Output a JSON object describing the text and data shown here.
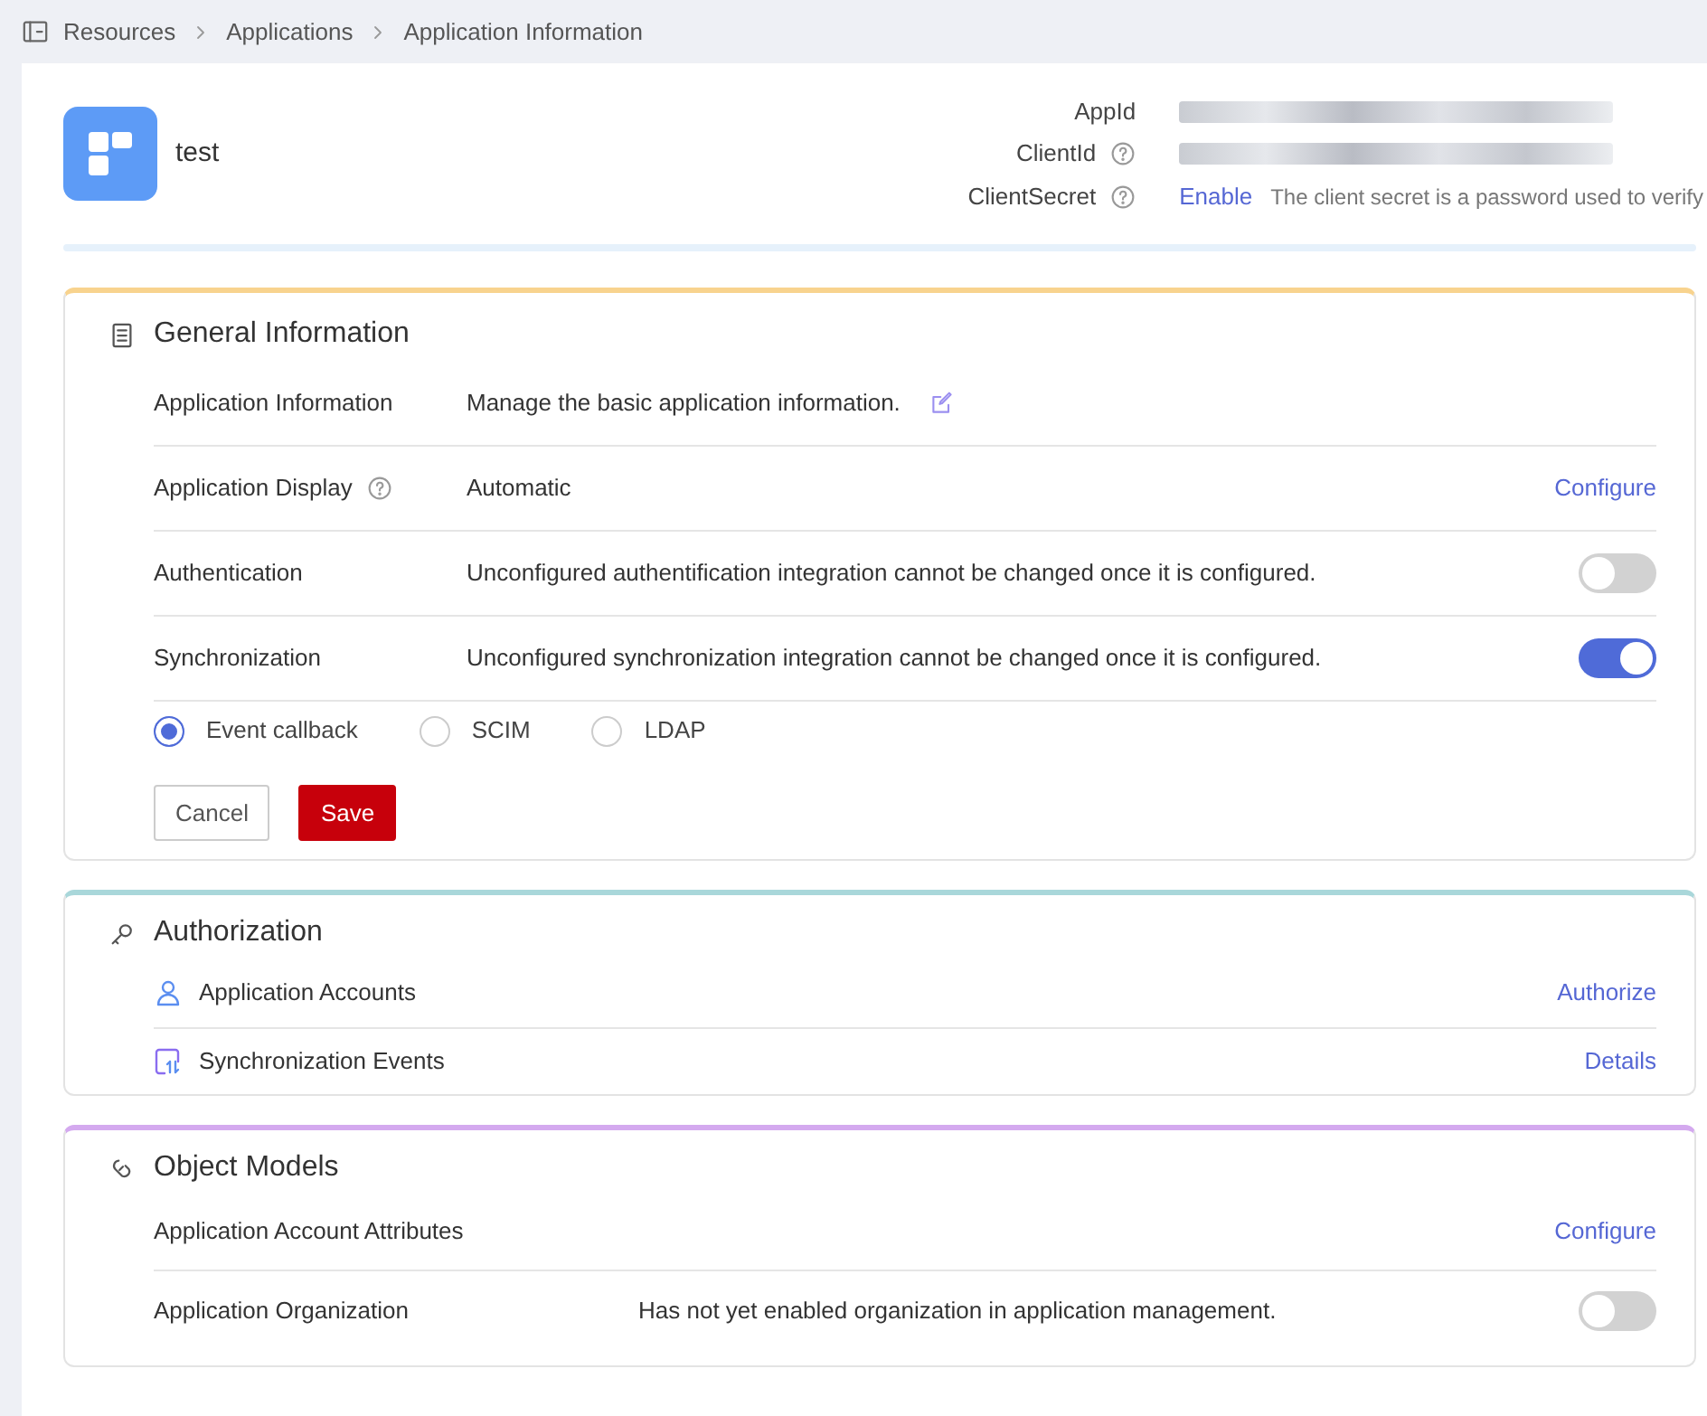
{
  "breadcrumb": [
    {
      "label": "Resources"
    },
    {
      "label": "Applications"
    },
    {
      "label": "Application Information"
    }
  ],
  "app": {
    "name": "test",
    "fields": [
      {
        "label": "AppId",
        "help": false,
        "kind": "masked"
      },
      {
        "label": "ClientId",
        "help": true,
        "kind": "masked"
      },
      {
        "label": "ClientSecret",
        "help": true,
        "kind": "secret",
        "link": "Enable",
        "note": "The client secret is a password used to verify"
      }
    ]
  },
  "sections": [
    {
      "title": "General Information",
      "color": "#f8d38e",
      "kind": "form",
      "rows": [
        {
          "label": "Application Information",
          "help": false,
          "description": "Manage the basic application information.",
          "action": {
            "kind": "edit"
          }
        },
        {
          "label": "Application Display",
          "help": true,
          "description": "Automatic",
          "action": {
            "kind": "link",
            "text": "Configure"
          }
        },
        {
          "label": "Authentication",
          "help": false,
          "description": "Unconfigured authentification integration cannot be changed once it is configured.",
          "action": {
            "kind": "toggle",
            "on": false
          }
        },
        {
          "label": "Synchronization",
          "help": false,
          "description": "Unconfigured synchronization integration cannot be changed once it is configured.",
          "action": {
            "kind": "toggle",
            "on": true
          }
        }
      ],
      "radios": [
        {
          "label": "Event callback",
          "selected": true
        },
        {
          "label": "SCIM",
          "selected": false
        },
        {
          "label": "LDAP",
          "selected": false
        }
      ],
      "buttons": [
        {
          "label": "Cancel",
          "kind": "secondary"
        },
        {
          "label": "Save",
          "kind": "primary"
        }
      ]
    },
    {
      "title": "Authorization",
      "color": "#a9d7da",
      "kind": "list",
      "rows": [
        {
          "label": "Application Accounts",
          "action": {
            "kind": "link",
            "text": "Authorize"
          }
        },
        {
          "label": "Synchronization Events",
          "action": {
            "kind": "link",
            "text": "Details"
          }
        }
      ]
    },
    {
      "title": "Object Models",
      "color": "#d4a9ef",
      "kind": "models",
      "rows": [
        {
          "label": "Application Account Attributes",
          "action": {
            "kind": "link",
            "text": "Configure"
          }
        },
        {
          "label": "Application Organization",
          "description": "Has not yet enabled organization in application management.",
          "action": {
            "kind": "toggle",
            "on": false
          }
        }
      ]
    }
  ]
}
